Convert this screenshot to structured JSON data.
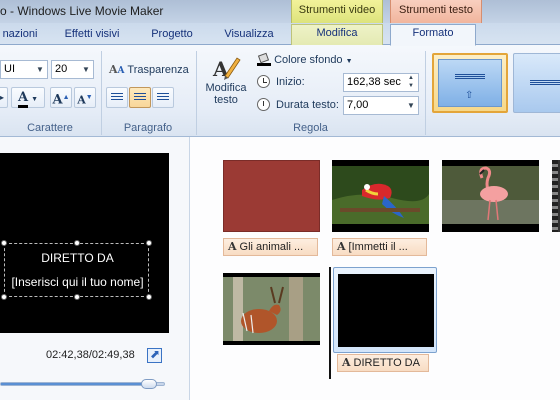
{
  "window": {
    "title": "o - Windows Live Movie Maker",
    "context_video_label": "Strumenti video",
    "context_text_label": "Strumenti testo"
  },
  "tabs": [
    {
      "label": "nazioni"
    },
    {
      "label": "Effetti visivi"
    },
    {
      "label": "Progetto"
    },
    {
      "label": "Visualizza"
    },
    {
      "label": "Modifica"
    },
    {
      "label": "Formato"
    }
  ],
  "ribbon": {
    "font": {
      "family_value": "UI",
      "size_value": "20",
      "group_label": "Carattere",
      "color_label": "A",
      "grow_label": "A",
      "shrink_label": "A"
    },
    "paragraph": {
      "transparency_label": "Trasparenza",
      "group_label": "Paragrafo"
    },
    "adjust": {
      "edit_text_label_1": "Modifica",
      "edit_text_label_2": "testo",
      "background_color_label": "Colore sfondo",
      "start_label": "Inizio:",
      "start_value": "162,38 sec",
      "duration_label": "Durata testo:",
      "duration_value": "7,00",
      "group_label": "Regola"
    }
  },
  "preview": {
    "caption_line1": "DIRETTO DA",
    "caption_line2": "[Inserisci qui il tuo nome]",
    "time": "02:42,38/02:49,38",
    "progress_fraction": 0.95
  },
  "storyboard": {
    "clips": [
      {
        "caption": "Gli animali ...",
        "kind": "title"
      },
      {
        "caption": "[Immetti il ...",
        "kind": "parrot"
      },
      {
        "caption": "",
        "kind": "flamingo"
      },
      {
        "caption": "",
        "kind": "antelope"
      },
      {
        "caption": "DIRETTO DA",
        "kind": "credits"
      }
    ]
  },
  "colors": {
    "accent": "#f1b59d",
    "context_video": "#dde37c",
    "title_clip": "#9b3a34",
    "caption_chip": "#f8dcc3"
  }
}
